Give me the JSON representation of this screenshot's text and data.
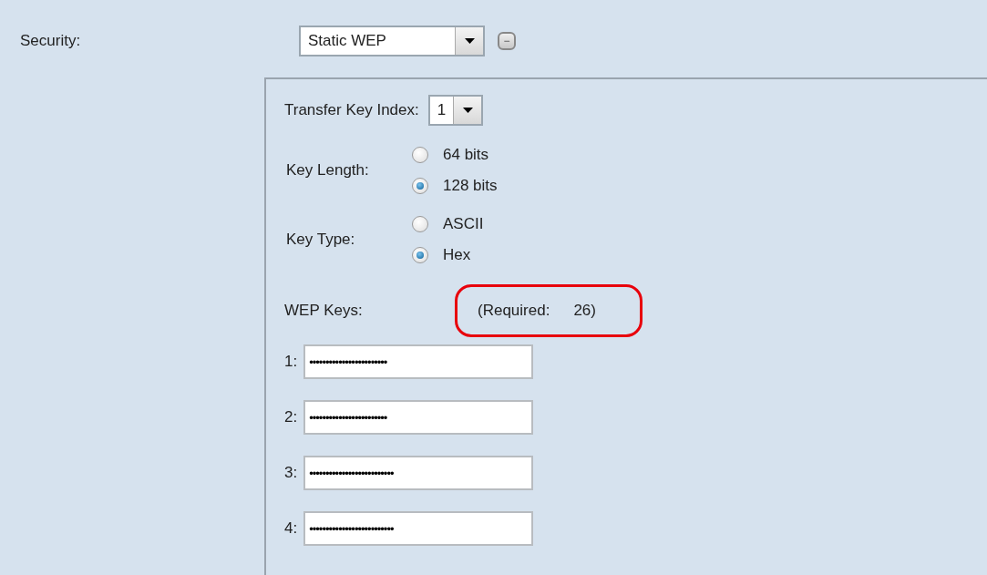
{
  "security": {
    "label": "Security:",
    "value": "Static WEP",
    "collapse_button": "−"
  },
  "transfer_key_index": {
    "label": "Transfer Key Index:",
    "value": "1"
  },
  "key_length": {
    "label": "Key Length:",
    "options": [
      {
        "label": "64 bits",
        "selected": false
      },
      {
        "label": "128 bits",
        "selected": true
      }
    ]
  },
  "key_type": {
    "label": "Key Type:",
    "options": [
      {
        "label": "ASCII",
        "selected": false
      },
      {
        "label": "Hex",
        "selected": true
      }
    ]
  },
  "wep_keys": {
    "label": "WEP Keys:",
    "required_label": "(Required:",
    "required_value": "26)",
    "highlighted": true,
    "keys": [
      {
        "label": "1:",
        "value": "••••••••••••••••••••••••"
      },
      {
        "label": "2:",
        "value": "••••••••••••••••••••••••"
      },
      {
        "label": "3:",
        "value": "••••••••••••••••••••••••••"
      },
      {
        "label": "4:",
        "value": "••••••••••••••••••••••••••"
      }
    ]
  }
}
